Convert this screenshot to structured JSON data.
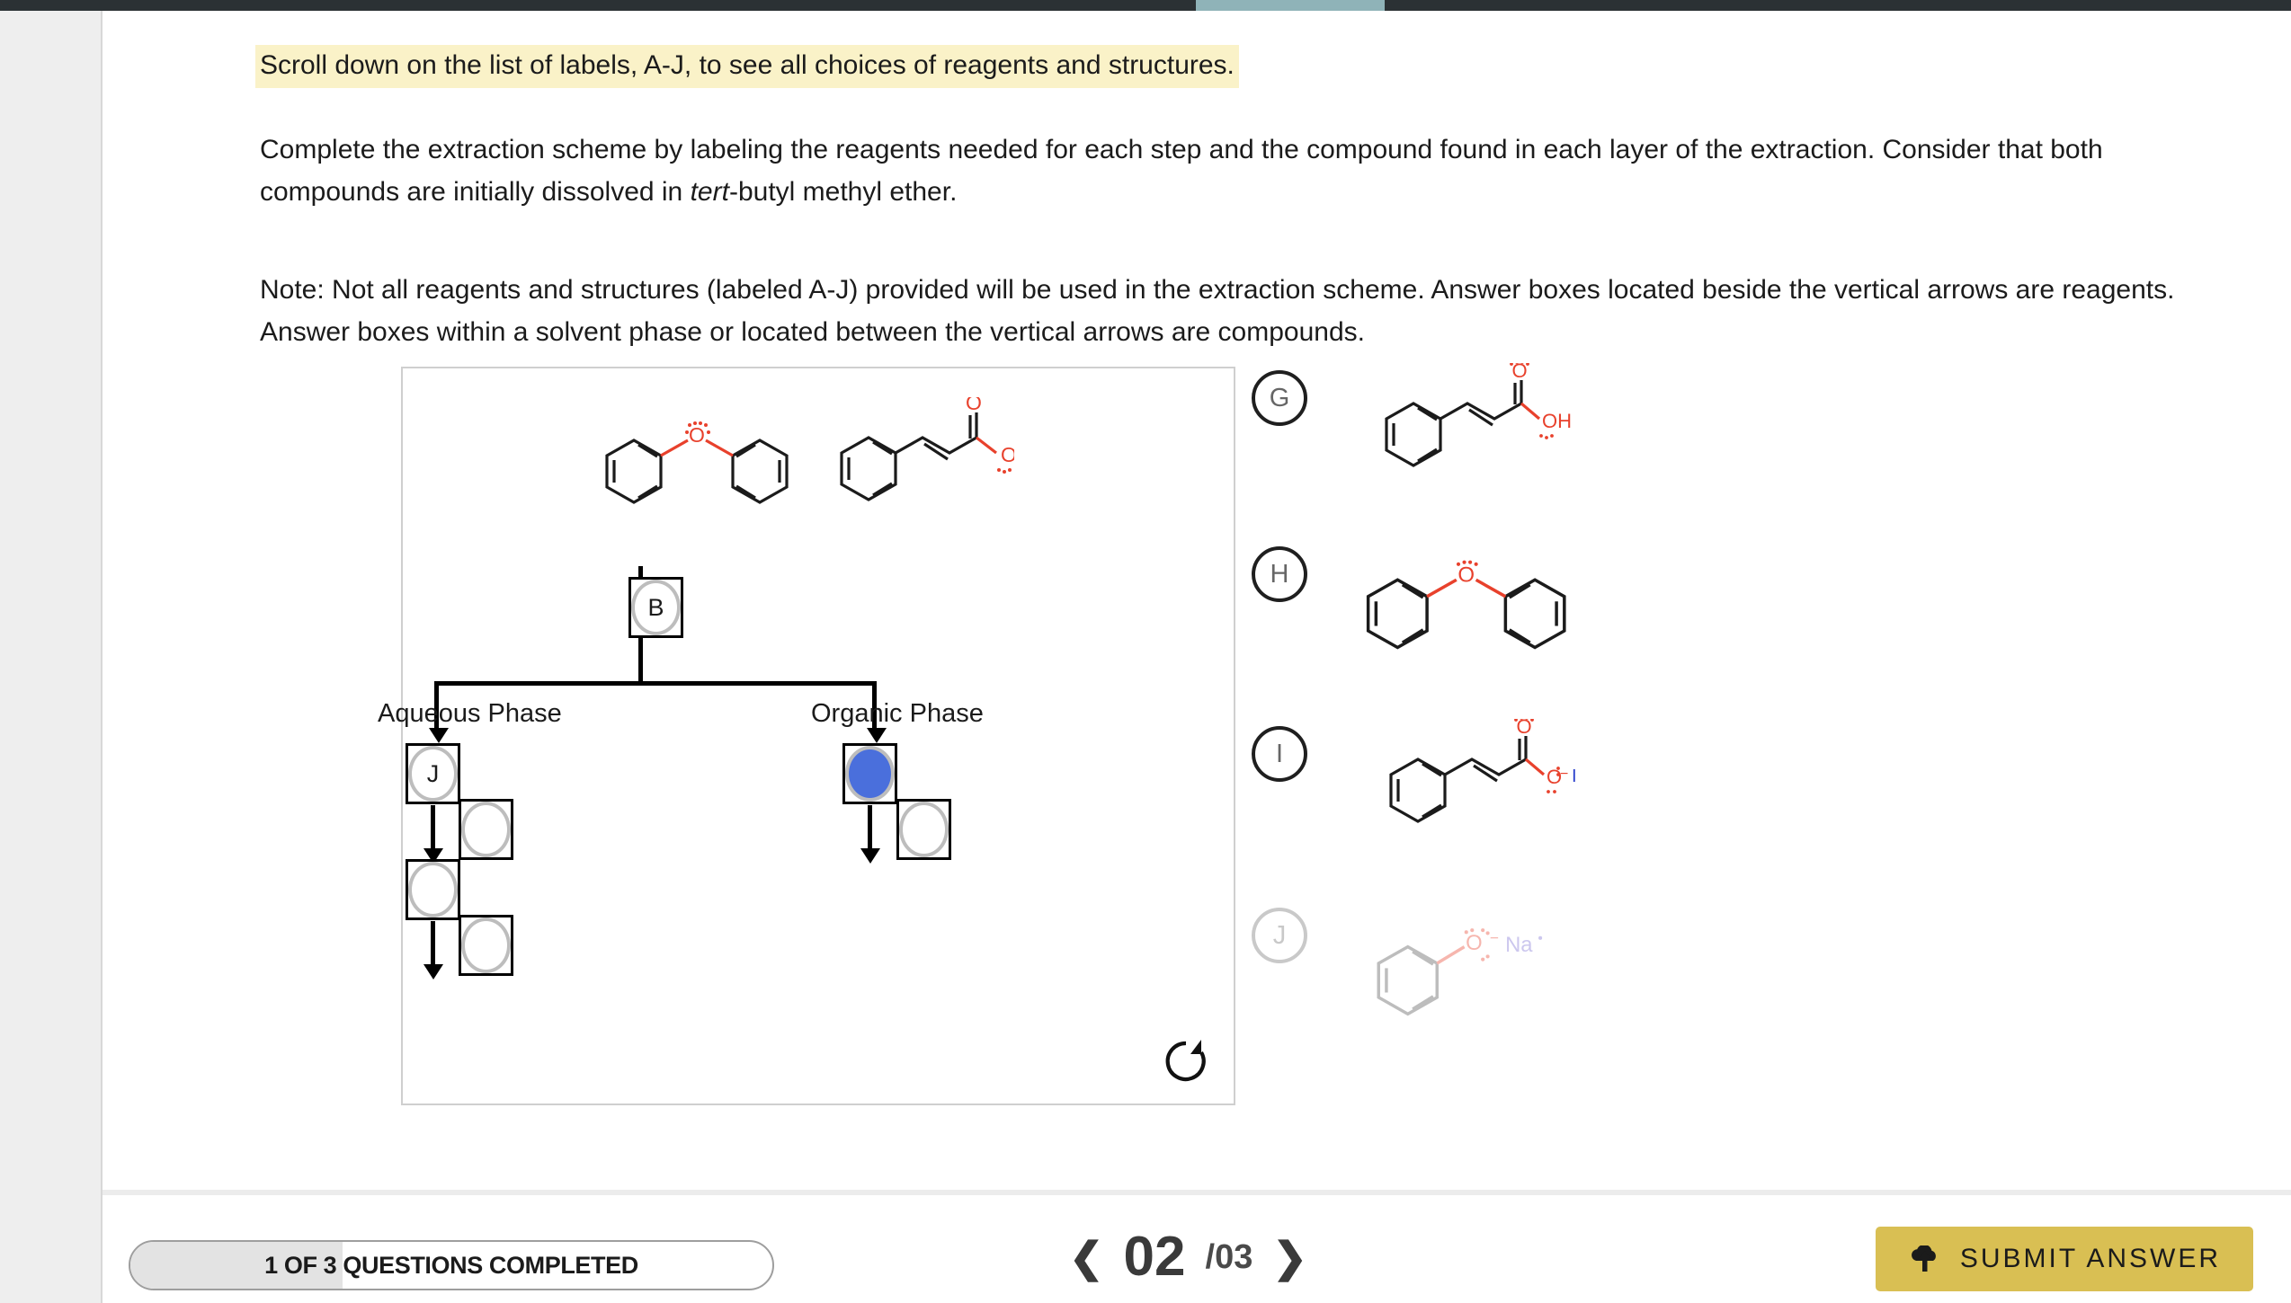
{
  "highlight_note": "Scroll down on the list of labels, A-J, to see all choices of reagents and structures.",
  "instructions": {
    "paragraph_1_part_a": "Complete the extraction scheme by labeling the reagents needed for each step and the compound found in each layer of the extraction. Consider that both compounds are initially dissolved in ",
    "paragraph_1_italic": "tert",
    "paragraph_1_part_b": "-butyl methyl ether.",
    "paragraph_2": "Note: Not all reagents and structures (labeled A-J) provided will be used in the extraction scheme. Answer boxes located beside the vertical arrows are reagents. Answer boxes within a solvent phase or located between the vertical arrows are compounds."
  },
  "scheme": {
    "starting_molecules": [
      {
        "name": "diphenyl ether",
        "formula_hint": "Ph-O-Ph"
      },
      {
        "name": "cinnamic acid",
        "formula_hint": "Ph-CH=CH-COOH"
      }
    ],
    "phase_labels": {
      "aqueous": "Aqueous Phase",
      "organic": "Organic Phase"
    },
    "answer_boxes": [
      {
        "id": "reagent-top",
        "value": "B",
        "state": "filled"
      },
      {
        "id": "aqueous-1",
        "value": "J",
        "state": "filled"
      },
      {
        "id": "aqueous-2",
        "value": "",
        "state": "empty"
      },
      {
        "id": "aqueous-3",
        "value": "",
        "state": "empty"
      },
      {
        "id": "aqueous-4",
        "value": "",
        "state": "empty"
      },
      {
        "id": "organic-1",
        "value": "",
        "state": "filled-blue"
      },
      {
        "id": "organic-2",
        "value": "",
        "state": "empty"
      }
    ],
    "reset_icon": "refresh-clockwise-icon"
  },
  "options": [
    {
      "label": "G",
      "used": false,
      "structure": "cinnamic acid",
      "atom_labels": [
        "O",
        "OH"
      ]
    },
    {
      "label": "H",
      "used": false,
      "structure": "diphenyl ether",
      "atom_labels": [
        "O"
      ]
    },
    {
      "label": "I",
      "used": false,
      "structure": "cinnamate iodide salt",
      "atom_labels": [
        "O",
        "O",
        "I"
      ]
    },
    {
      "label": "J",
      "used": true,
      "structure": "sodium phenoxide",
      "atom_labels": [
        "O",
        "Na"
      ]
    }
  ],
  "footer": {
    "progress_text": "1 OF 3 QUESTIONS COMPLETED",
    "progress_percent": 33,
    "pager": {
      "prev_icon": "chevron-left-icon",
      "current": "02",
      "total": "/03",
      "next_icon": "chevron-right-icon"
    },
    "submit_label": "SUBMIT ANSWER",
    "submit_icon": "cloud-upload-icon"
  },
  "colors": {
    "highlight": "#faf2c8",
    "submit_button": "#d9bf53",
    "filled_blue": "#4a6fdc",
    "oxygen_red": "#e8412c",
    "iodine_blue": "#2a3fcc",
    "sodium_purple": "#7b6fd4",
    "top_accent": "#8fb3b8"
  }
}
